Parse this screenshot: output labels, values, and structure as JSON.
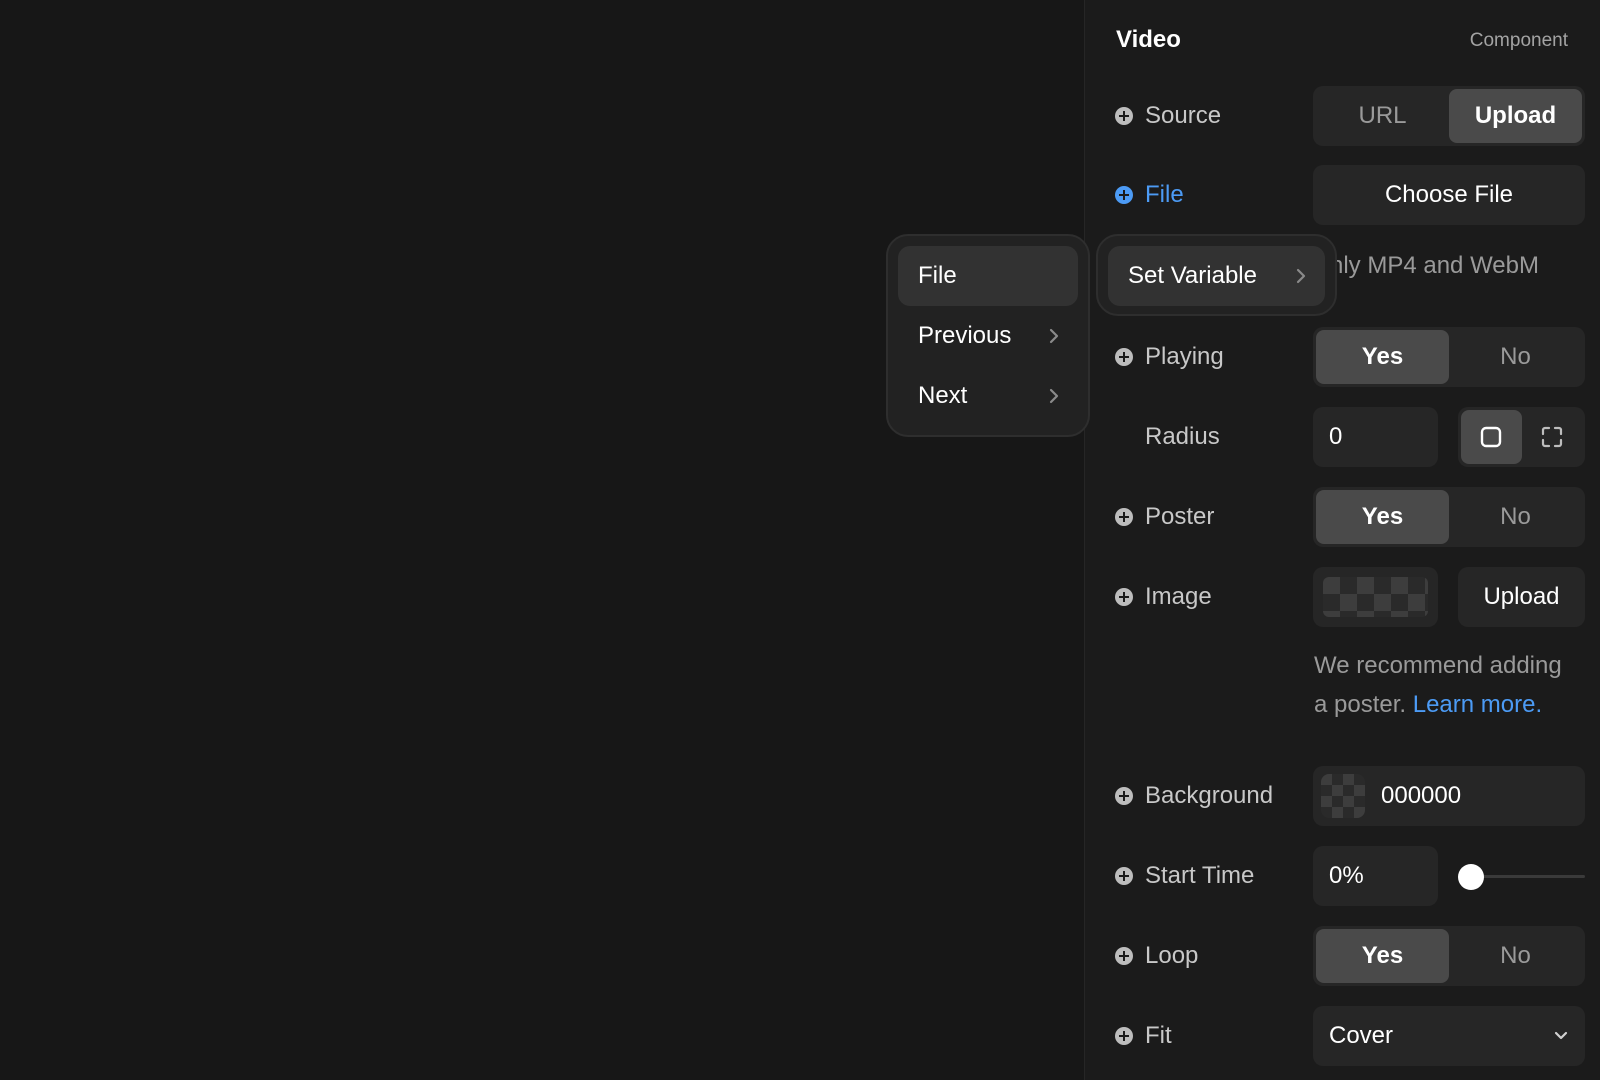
{
  "panel": {
    "title": "Video",
    "tag": "Component"
  },
  "source": {
    "label": "Source",
    "options": [
      "URL",
      "Upload"
    ],
    "selected": "Upload"
  },
  "file": {
    "label": "File",
    "button": "Choose File",
    "note": "nly MP4 and WebM"
  },
  "playing": {
    "label": "Playing",
    "options": [
      "Yes",
      "No"
    ],
    "selected": "Yes"
  },
  "radius": {
    "label": "Radius",
    "value": "0"
  },
  "poster": {
    "label": "Poster",
    "options": [
      "Yes",
      "No"
    ],
    "selected": "Yes"
  },
  "image": {
    "label": "Image",
    "button": "Upload",
    "note_line1": "We recommend adding",
    "note_line2": "a poster.",
    "note_link": "Learn more."
  },
  "background": {
    "label": "Background",
    "value": "000000"
  },
  "start_time": {
    "label": "Start Time",
    "value": "0%",
    "slider_fraction": 0
  },
  "loop": {
    "label": "Loop",
    "options": [
      "Yes",
      "No"
    ],
    "selected": "Yes"
  },
  "fit": {
    "label": "Fit",
    "value": "Cover"
  },
  "context_menu": {
    "items": [
      "File",
      "Previous",
      "Next"
    ]
  },
  "submenu": {
    "item": "Set Variable"
  },
  "colors": {
    "accent": "#4c9bf5",
    "panel_bg": "#1b1b1b",
    "control_bg": "#262626"
  }
}
